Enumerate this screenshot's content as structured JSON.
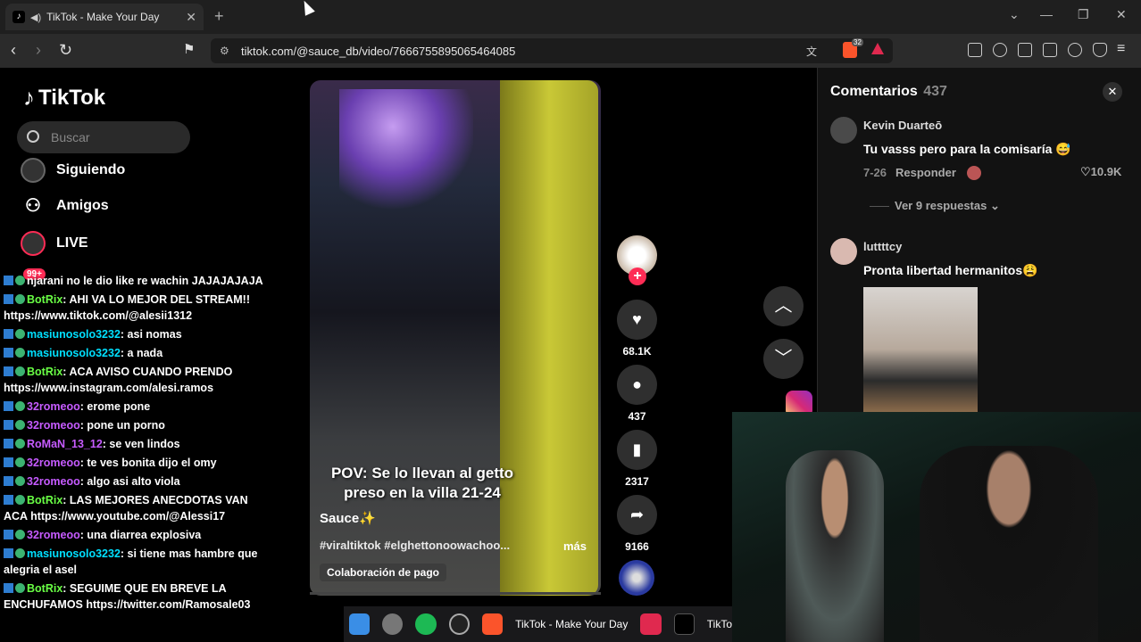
{
  "browser": {
    "tab_title": "TikTok - Make Your Day",
    "new_tab": "+",
    "url": "tiktok.com/@sauce_db/video/7666755895065464085",
    "shield_badge": "32"
  },
  "sidebar": {
    "logo": "TikTok",
    "search_placeholder": "Buscar",
    "items": [
      {
        "label": "Siguiendo"
      },
      {
        "label": "Amigos"
      },
      {
        "label": "LIVE"
      }
    ],
    "notif_badge": "99+"
  },
  "chat": [
    {
      "user": "",
      "msg": "njarani no le dio like re wachin JAJAJAJAJA",
      "color": "cyan"
    },
    {
      "user": "BotRix",
      "msg": "AHI VA LO MEJOR DEL STREAM!! https://www.tiktok.com/@alesii1312",
      "color": "green"
    },
    {
      "user": "masiunosolo3232",
      "msg": "asi nomas",
      "color": "cyan"
    },
    {
      "user": "masiunosolo3232",
      "msg": "a nada",
      "color": "cyan"
    },
    {
      "user": "BotRix",
      "msg": "ACA AVISO CUANDO PRENDO https://www.instagram.com/alesi.ramos",
      "color": "green"
    },
    {
      "user": "32romeoo",
      "msg": "erome pone",
      "color": "purple"
    },
    {
      "user": "32romeoo",
      "msg": "pone un porno",
      "color": "purple"
    },
    {
      "user": "RoMaN_13_12",
      "msg": "se ven lindos",
      "color": "purple"
    },
    {
      "user": "32romeoo",
      "msg": "te ves bonita dijo el omy",
      "color": "purple"
    },
    {
      "user": "32romeoo",
      "msg": "algo asi alto viola",
      "color": "purple"
    },
    {
      "user": "BotRix",
      "msg": "LAS MEJORES ANECDOTAS VAN ACA https://www.youtube.com/@Alessi17",
      "color": "green"
    },
    {
      "user": "32romeoo",
      "msg": "una diarrea explosiva",
      "color": "purple"
    },
    {
      "user": "masiunosolo3232",
      "msg": "si tiene mas hambre que alegria el asel",
      "color": "cyan"
    },
    {
      "user": "BotRix",
      "msg": "SEGUIME QUE EN BREVE LA ENCHUFAMOS https://twitter.com/Ramosale03",
      "color": "green"
    }
  ],
  "video": {
    "caption": "POV: Se lo llevan al getto preso en la villa 21-24",
    "author": "Sauce✨",
    "tags": "#viraltiktok #elghettonoowachoo...",
    "more": "más",
    "collab": "Colaboración de pago",
    "likes": "68.1K",
    "comments": "437",
    "saves": "2317",
    "shares": "9166"
  },
  "comments_panel": {
    "title": "Comentarios",
    "count": "437",
    "items": [
      {
        "user": "Kevin Duarteō",
        "text": "Tu vasss pero para la comisaría 😅",
        "date": "7-26",
        "reply": "Responder",
        "likes": "10.9K",
        "replies": "Ver 9 respuestas"
      },
      {
        "user": "luttttcy",
        "text": "Pronta libertad hermanitos😩"
      }
    ]
  },
  "taskbar": {
    "label": "TikTok - Make Your Day",
    "label2": "TikTo"
  },
  "colors": {
    "accent": "#fe2c55",
    "bg": "#000000",
    "panel": "#121212"
  }
}
